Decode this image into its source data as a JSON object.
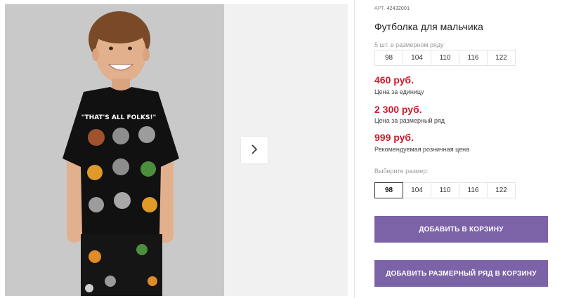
{
  "product": {
    "article_prefix": "АРТ.",
    "article_number": "42432001",
    "title": "Футболка для мальчика",
    "pack_note": "5 шт. в размерном ряду",
    "pack_sizes": [
      "98",
      "104",
      "110",
      "116",
      "122"
    ]
  },
  "prices": {
    "unit_price": "460 руб.",
    "unit_label": "Цена за единицу",
    "set_price": "2 300 руб.",
    "set_label": "Цена за размерный ряд",
    "retail_price": "999 руб.",
    "retail_label": "Рекомендуемая розничная цена"
  },
  "size_select": {
    "label": "Выберите размер:",
    "options": [
      "98",
      "104",
      "110",
      "116",
      "122"
    ],
    "selected": "98"
  },
  "buttons": {
    "add_to_cart": "ДОБАВИТЬ В КОРЗИНУ",
    "add_set_to_cart": "ДОБАВИТЬ РАЗМЕРНЫЙ РЯД В КОРЗИНУ"
  },
  "gallery": {
    "print_caption": "\"THAT'S ALL FOLKS!\""
  },
  "colors": {
    "price": "#d0192c",
    "button": "#7c62a6"
  }
}
